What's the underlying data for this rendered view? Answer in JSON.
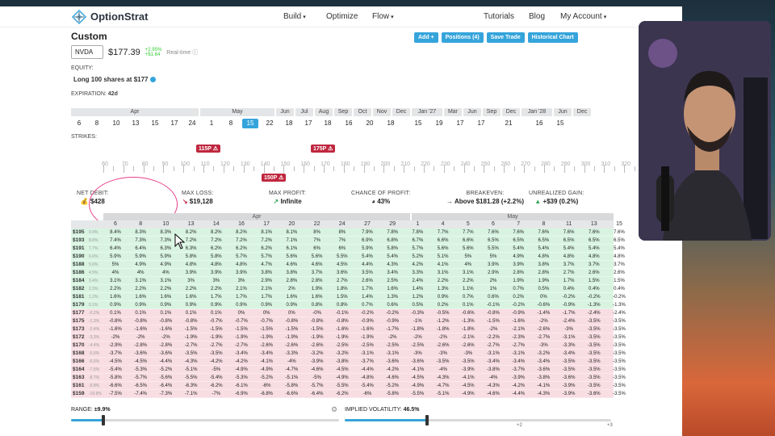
{
  "app": {
    "name": "OptionStrat",
    "nav": [
      "Build",
      "Optimize",
      "Flow",
      "Tutorials",
      "Blog",
      "My Account"
    ]
  },
  "page": {
    "title": "Custom"
  },
  "toolbar": {
    "add": "Add +",
    "positions": "Positions (4)",
    "save": "Save Trade",
    "chart": "Historical Chart"
  },
  "symbol": {
    "ticker": "NVDA",
    "price": "$177.39",
    "change_pct": "+2.95%",
    "change_abs": "+$1.64",
    "realtime": "Real-time"
  },
  "equity": {
    "label": "EQUITY:",
    "value": "Long 100 shares at $177"
  },
  "expiration": {
    "label": "EXPIRATION:",
    "days": "42d",
    "months": [
      {
        "m": "Apr",
        "w": 160
      },
      {
        "m": "May",
        "w": 94
      },
      {
        "m": "Jun",
        "w": 24
      },
      {
        "m": "Jul",
        "w": 24
      },
      {
        "m": "Aug",
        "w": 24
      },
      {
        "m": "Sep",
        "w": 24
      },
      {
        "m": "Oct",
        "w": 24
      },
      {
        "m": "Nov",
        "w": 24
      },
      {
        "m": "Dec",
        "w": 24
      },
      {
        "m": "Jan '27",
        "w": 40
      },
      {
        "m": "Mar",
        "w": 24
      },
      {
        "m": "Jun",
        "w": 24
      },
      {
        "m": "Sep",
        "w": 24
      },
      {
        "m": "Dec",
        "w": 24
      },
      {
        "m": "Jan '28",
        "w": 40
      },
      {
        "m": "Jun",
        "w": 24
      },
      {
        "m": "Dec",
        "w": 24
      }
    ],
    "dates": [
      "6",
      "8",
      "10",
      "13",
      "15",
      "17",
      "24",
      "1",
      "8",
      "15",
      "22",
      "18",
      "17",
      "18",
      "16",
      "20",
      "18",
      "15",
      "19",
      "17",
      "17",
      "21",
      "16",
      "15"
    ],
    "selected": "15"
  },
  "strikes": {
    "label": "STRIKES:",
    "values": [
      "60",
      "70",
      "80",
      "90",
      "100",
      "110",
      "120",
      "130",
      "140",
      "150",
      "160",
      "170",
      "180",
      "190",
      "200",
      "210",
      "220",
      "230",
      "240",
      "250",
      "260",
      "270",
      "280",
      "290",
      "300",
      "310",
      "320"
    ],
    "tags": [
      "115P",
      "175P",
      "150P"
    ]
  },
  "stats": [
    {
      "k": "NET DEBIT:",
      "v": "$428",
      "icon": "coins-icon"
    },
    {
      "k": "MAX LOSS:",
      "v": "$19,128",
      "icon": "down-arrow-icon"
    },
    {
      "k": "MAX PROFIT:",
      "v": "Infinite",
      "icon": "up-arrow-icon"
    },
    {
      "k": "CHANCE OF PROFIT:",
      "v": "43%",
      "icon": "pie-icon"
    },
    {
      "k": "BREAKEVEN:",
      "v": "Above $181.28 (+2.2%)",
      "icon": "arrow-right-icon"
    },
    {
      "k": "UNREALIZED GAIN:",
      "v": "+$39 (0.2%)",
      "icon": "triangle-up-icon"
    }
  ],
  "grid": {
    "months": [
      "Apr",
      "May"
    ],
    "days": [
      "6",
      "8",
      "10",
      "13",
      "14",
      "16",
      "17",
      "20",
      "22",
      "24",
      "27",
      "29",
      "1",
      "4",
      "5",
      "6",
      "7",
      "8",
      "11",
      "13",
      "15"
    ],
    "rows": [
      {
        "p": "$195",
        "pc": "9.9%",
        "v": [
          "8.4%",
          "8.3%",
          "8.3%",
          "8.2%",
          "8.2%",
          "8.2%",
          "8.1%",
          "8.1%",
          "8%",
          "8%",
          "7.9%",
          "7.8%",
          "7.8%",
          "7.7%",
          "7.7%",
          "7.6%",
          "7.6%",
          "7.6%",
          "7.6%",
          "7.6%",
          "7.6%"
        ]
      },
      {
        "p": "$193",
        "pc": "8.8%",
        "v": [
          "7.4%",
          "7.3%",
          "7.3%",
          "7.2%",
          "7.2%",
          "7.2%",
          "7.2%",
          "7.1%",
          "7%",
          "7%",
          "6.9%",
          "6.8%",
          "6.7%",
          "6.6%",
          "6.6%",
          "6.5%",
          "6.5%",
          "6.5%",
          "6.5%",
          "6.5%",
          "6.5%"
        ]
      },
      {
        "p": "$191",
        "pc": "7.7%",
        "v": [
          "6.4%",
          "6.4%",
          "6.3%",
          "6.3%",
          "6.2%",
          "6.2%",
          "6.2%",
          "6.1%",
          "6%",
          "6%",
          "5.9%",
          "5.8%",
          "5.7%",
          "5.6%",
          "5.6%",
          "5.5%",
          "5.4%",
          "5.4%",
          "5.4%",
          "5.4%",
          "5.4%"
        ]
      },
      {
        "p": "$190",
        "pc": "6.6%",
        "v": [
          "5.9%",
          "5.9%",
          "5.9%",
          "5.8%",
          "5.8%",
          "5.7%",
          "5.7%",
          "5.6%",
          "5.6%",
          "5.5%",
          "5.4%",
          "5.4%",
          "5.2%",
          "5.1%",
          "5%",
          "5%",
          "4.9%",
          "4.8%",
          "4.8%",
          "4.8%",
          "4.8%"
        ]
      },
      {
        "p": "$188",
        "pc": "5.6%",
        "v": [
          "5%",
          "4.9%",
          "4.9%",
          "4.8%",
          "4.8%",
          "4.8%",
          "4.7%",
          "4.6%",
          "4.6%",
          "4.5%",
          "4.4%",
          "4.3%",
          "4.2%",
          "4.1%",
          "4%",
          "3.9%",
          "3.9%",
          "3.8%",
          "3.7%",
          "3.7%",
          "3.7%"
        ]
      },
      {
        "p": "$186",
        "pc": "4.5%",
        "v": [
          "4%",
          "4%",
          "4%",
          "3.9%",
          "3.9%",
          "3.9%",
          "3.8%",
          "3.8%",
          "3.7%",
          "3.6%",
          "3.5%",
          "3.4%",
          "3.3%",
          "3.1%",
          "3.1%",
          "2.9%",
          "2.8%",
          "2.8%",
          "2.7%",
          "2.6%",
          "2.6%"
        ]
      },
      {
        "p": "$184",
        "pc": "3.4%",
        "v": [
          "3.1%",
          "3.1%",
          "3.1%",
          "3%",
          "3%",
          "3%",
          "2.9%",
          "2.8%",
          "2.8%",
          "2.7%",
          "2.6%",
          "2.5%",
          "2.4%",
          "2.2%",
          "2.2%",
          "2%",
          "1.9%",
          "1.9%",
          "1.7%",
          "1.5%",
          "1.5%"
        ]
      },
      {
        "p": "$182",
        "pc": "2.3%",
        "v": [
          "2.2%",
          "2.2%",
          "2.2%",
          "2.2%",
          "2.2%",
          "2.1%",
          "2.1%",
          "2%",
          "1.9%",
          "1.8%",
          "1.7%",
          "1.6%",
          "1.4%",
          "1.3%",
          "1.1%",
          "1%",
          "0.7%",
          "0.5%",
          "0.4%",
          "0.4%",
          "0.4%"
        ]
      },
      {
        "p": "$181",
        "pc": "1.2%",
        "v": [
          "1.6%",
          "1.6%",
          "1.6%",
          "1.6%",
          "1.7%",
          "1.7%",
          "1.7%",
          "1.6%",
          "1.6%",
          "1.5%",
          "1.4%",
          "1.3%",
          "1.2%",
          "0.9%",
          "0.7%",
          "0.6%",
          "0.2%",
          "0%",
          "-0.2%",
          "-0.2%",
          "-0.2%"
        ]
      },
      {
        "p": "$179",
        "pc": "0.1%",
        "v": [
          "0.9%",
          "0.9%",
          "0.9%",
          "0.9%",
          "0.9%",
          "0.9%",
          "0.9%",
          "0.9%",
          "0.8%",
          "0.8%",
          "0.7%",
          "0.6%",
          "0.5%",
          "0.2%",
          "0.1%",
          "-0.1%",
          "-0.2%",
          "-0.6%",
          "-0.9%",
          "-1.3%",
          "-1.3%"
        ]
      },
      {
        "p": "$177",
        "pc": "-0.2%",
        "v": [
          "0.1%",
          "0.1%",
          "0.1%",
          "0.1%",
          "0.1%",
          "0%",
          "0%",
          "0%",
          "-0%",
          "-0.1%",
          "-0.2%",
          "-0.2%",
          "-0.3%",
          "-0.5%",
          "-0.6%",
          "-0.8%",
          "-0.9%",
          "-1.4%",
          "-1.7%",
          "-2.4%",
          "-2.4%"
        ]
      },
      {
        "p": "$175",
        "pc": "-1.3%",
        "v": [
          "-0.8%",
          "-0.8%",
          "-0.8%",
          "-0.8%",
          "-0.7%",
          "-0.7%",
          "-0.7%",
          "-0.8%",
          "-0.8%",
          "-0.8%",
          "-0.9%",
          "-0.9%",
          "-1%",
          "-1.2%",
          "-1.3%",
          "-1.5%",
          "-1.6%",
          "-2%",
          "-2.4%",
          "-3.5%",
          "-3.5%"
        ]
      },
      {
        "p": "$173",
        "pc": "-2.4%",
        "v": [
          "-1.6%",
          "-1.6%",
          "-1.6%",
          "-1.5%",
          "-1.5%",
          "-1.5%",
          "-1.5%",
          "-1.5%",
          "-1.5%",
          "-1.6%",
          "-1.6%",
          "-1.7%",
          "-1.8%",
          "-1.8%",
          "-1.8%",
          "-2%",
          "-2.1%",
          "-2.6%",
          "-3%",
          "-3.5%",
          "-3.5%"
        ]
      },
      {
        "p": "$172",
        "pc": "-3.3%",
        "v": [
          "-2%",
          "-2%",
          "-2%",
          "-1.9%",
          "-1.9%",
          "-1.9%",
          "-1.9%",
          "-1.9%",
          "-1.9%",
          "-1.9%",
          "-1.9%",
          "-2%",
          "-2%",
          "-2%",
          "-2.1%",
          "-2.2%",
          "-2.3%",
          "-2.7%",
          "-3.1%",
          "-3.5%",
          "-3.5%"
        ]
      },
      {
        "p": "$170",
        "pc": "-4.4%",
        "v": [
          "-2.9%",
          "-2.8%",
          "-2.8%",
          "-2.7%",
          "-2.7%",
          "-2.7%",
          "-2.6%",
          "-2.6%",
          "-2.6%",
          "-2.5%",
          "-2.5%",
          "-2.5%",
          "-2.5%",
          "-2.6%",
          "-2.6%",
          "-2.7%",
          "-2.7%",
          "-3%",
          "-3.3%",
          "-3.5%",
          "-3.5%"
        ]
      },
      {
        "p": "$168",
        "pc": "-5.5%",
        "v": [
          "-3.7%",
          "-3.6%",
          "-3.6%",
          "-3.5%",
          "-3.5%",
          "-3.4%",
          "-3.4%",
          "-3.3%",
          "-3.2%",
          "-3.2%",
          "-3.1%",
          "-3.1%",
          "-3%",
          "-3%",
          "-3%",
          "-3.1%",
          "-3.1%",
          "-3.2%",
          "-3.4%",
          "-3.5%",
          "-3.5%"
        ]
      },
      {
        "p": "$166",
        "pc": "-6.6%",
        "v": [
          "-4.5%",
          "-4.5%",
          "-4.4%",
          "-4.3%",
          "-4.2%",
          "-4.2%",
          "-4.1%",
          "-4%",
          "-3.9%",
          "-3.8%",
          "-3.7%",
          "-3.6%",
          "-3.6%",
          "-3.5%",
          "-3.5%",
          "-3.4%",
          "-3.4%",
          "-3.4%",
          "-3.5%",
          "-3.5%",
          "-3.5%"
        ]
      },
      {
        "p": "$164",
        "pc": "-7.5%",
        "v": [
          "-5.4%",
          "-5.3%",
          "-5.2%",
          "-5.1%",
          "-5%",
          "-4.9%",
          "-4.9%",
          "-4.7%",
          "-4.6%",
          "-4.5%",
          "-4.4%",
          "-4.2%",
          "-4.1%",
          "-4%",
          "-3.9%",
          "-3.8%",
          "-3.7%",
          "-3.6%",
          "-3.5%",
          "-3.5%",
          "-3.5%"
        ]
      },
      {
        "p": "$163",
        "pc": "-8.7%",
        "v": [
          "-5.8%",
          "-5.7%",
          "-5.6%",
          "-5.5%",
          "-5.4%",
          "-5.3%",
          "-5.2%",
          "-5.1%",
          "-5%",
          "-4.9%",
          "-4.8%",
          "-4.6%",
          "-4.5%",
          "-4.3%",
          "-4.1%",
          "-4%",
          "-3.9%",
          "-3.8%",
          "-3.6%",
          "-3.5%",
          "-3.5%"
        ]
      },
      {
        "p": "$161",
        "pc": "-9.8%",
        "v": [
          "-6.6%",
          "-6.5%",
          "-6.4%",
          "-6.3%",
          "-6.2%",
          "-6.1%",
          "-6%",
          "-5.8%",
          "-5.7%",
          "-5.5%",
          "-5.4%",
          "-5.2%",
          "-4.9%",
          "-4.7%",
          "-4.5%",
          "-4.3%",
          "-4.2%",
          "-4.1%",
          "-3.9%",
          "-3.5%",
          "-3.5%"
        ]
      },
      {
        "p": "$159",
        "pc": "-10.9%",
        "v": [
          "-7.5%",
          "-7.4%",
          "-7.3%",
          "-7.1%",
          "-7%",
          "-6.9%",
          "-6.8%",
          "-6.6%",
          "-6.4%",
          "-6.2%",
          "-6%",
          "-5.8%",
          "-5.5%",
          "-5.1%",
          "-4.9%",
          "-4.6%",
          "-4.4%",
          "-4.3%",
          "-3.9%",
          "-3.6%",
          "-3.5%"
        ]
      }
    ]
  },
  "range": {
    "label": "RANGE:",
    "value": "±9.9%",
    "fill": 0.12
  },
  "iv": {
    "label": "IMPLIED VOLATILITY:",
    "value": "46.5%",
    "fill": 0.31,
    "ticks": [
      "+2",
      "+3"
    ]
  },
  "colors": {
    "accent": "#35a4db",
    "put_tag": "#c0273f",
    "profit": "#d8f4e1",
    "loss": "#f8dde3"
  }
}
